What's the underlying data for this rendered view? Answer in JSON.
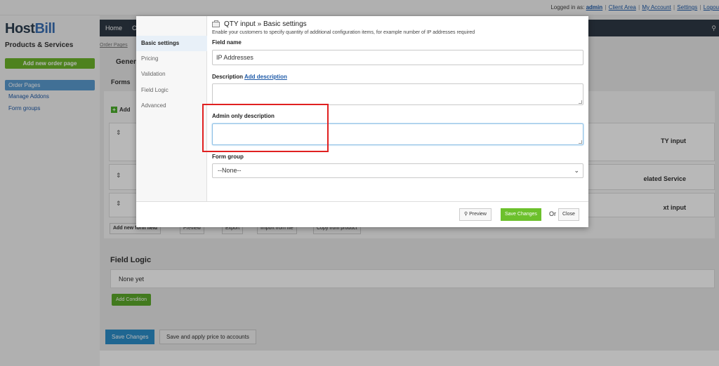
{
  "topbar": {
    "logged_in_as": "Logged in as:",
    "user": "admin",
    "links": [
      "Client Area",
      "My Account",
      "Settings",
      "Logou"
    ]
  },
  "sidebar": {
    "logo_host": "Host",
    "logo_bill": "Bill",
    "section_title": "Products & Services",
    "add_button": "Add new order page",
    "items": [
      {
        "label": "Order Pages",
        "active": true
      },
      {
        "label": "Manage Addons",
        "active": false
      },
      {
        "label": "Form groups",
        "active": false
      }
    ]
  },
  "main": {
    "nav_home": "Home",
    "nav_c": "C",
    "breadcrumb": "Order Pages",
    "general_tab": "Gener",
    "forms_tab": "Forms",
    "add_mini": "Add",
    "rows": [
      {
        "text": "TY input"
      },
      {
        "text": "elated Service"
      },
      {
        "text": "xt input"
      }
    ],
    "toolbar": [
      "Add new form field",
      "Preview",
      "Export",
      "Import from file",
      "Copy from product"
    ],
    "field_logic_title": "Field Logic",
    "field_logic_empty": "None yet",
    "add_condition": "Add Condition",
    "save_changes": "Save Changes",
    "save_apply": "Save and apply price to accounts"
  },
  "modal": {
    "title": "QTY input » Basic settings",
    "subtitle": "Enable your customers to specify quantity of additional configuration items, for example number of IP addresses required",
    "tabs": [
      "Basic settings",
      "Pricing",
      "Validation",
      "Field Logic",
      "Advanced"
    ],
    "field_name_label": "Field name",
    "field_name_value": "IP Addresses",
    "description_label": "Description",
    "add_description_link": "Add description",
    "admin_desc_label": "Admin only description",
    "form_group_label": "Form group",
    "form_group_value": "--None--",
    "preview_btn": "Preview",
    "save_btn": "Save Changes",
    "or_text": "Or",
    "close_btn": "Close"
  },
  "colors": {
    "accent_green": "#6cc02c",
    "accent_blue": "#2b8ec9",
    "highlight_red": "#e02020"
  }
}
